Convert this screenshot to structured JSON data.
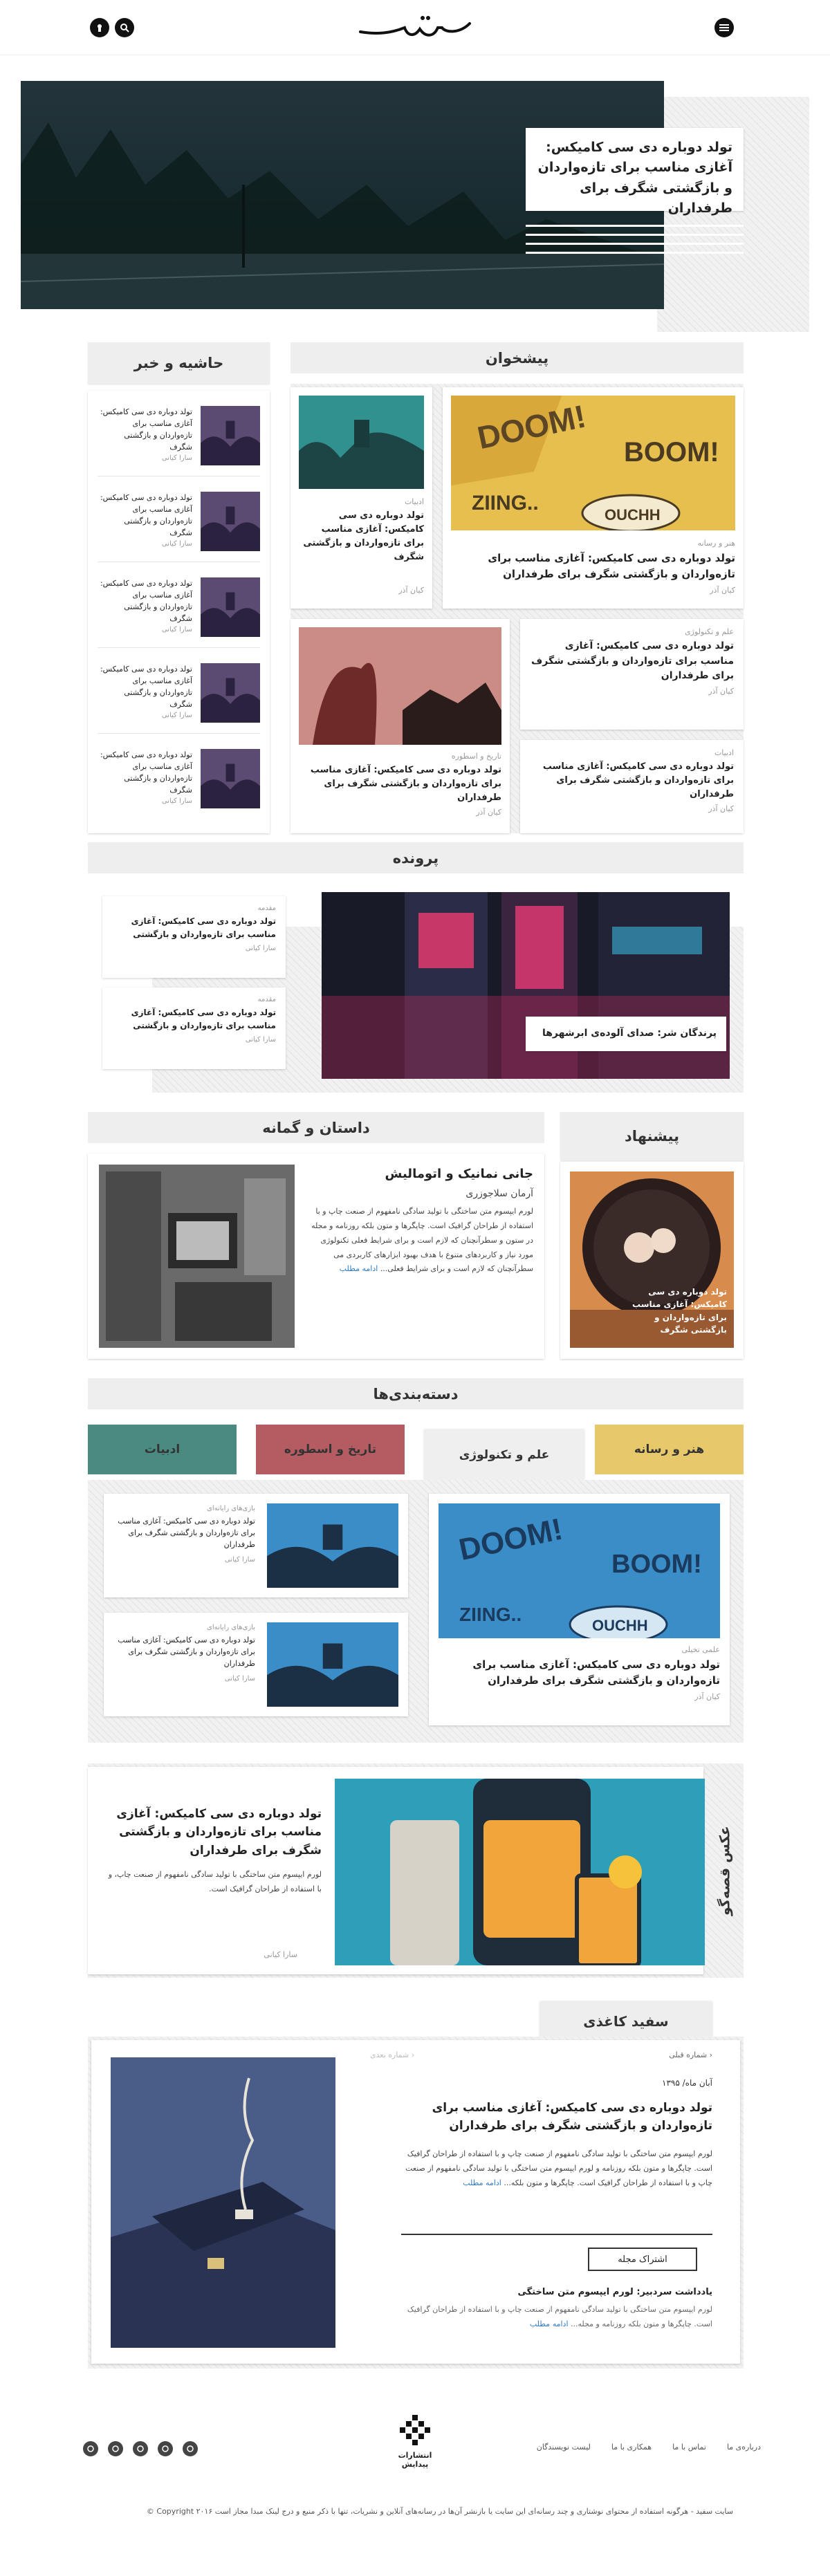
{
  "header": {
    "logo_text": "سفید"
  },
  "hero": {
    "title": "تولد دوباره دی سی کامیکس: آغازی مناسب برای تازه‌واردان و بازگشتی شگرف برای طرفداران"
  },
  "sidebar": {
    "title": "حاشیه و خبر",
    "items": [
      {
        "title": "تولد دوباره دی سی کامیکس: آغازی مناسب برای تازه‌واردان و بازگشتی شگرف",
        "author": "سارا کیانی"
      },
      {
        "title": "تولد دوباره دی سی کامیکس: آغازی مناسب برای تازه‌واردان و بازگشتی شگرف",
        "author": "سارا کیانی"
      },
      {
        "title": "تولد دوباره دی سی کامیکس: آغازی مناسب برای تازه‌واردان و بازگشتی شگرف",
        "author": "سارا کیانی"
      },
      {
        "title": "تولد دوباره دی سی کامیکس: آغازی مناسب برای تازه‌واردان و بازگشتی شگرف",
        "author": "سارا کیانی"
      },
      {
        "title": "تولد دوباره دی سی کامیکس: آغازی مناسب برای تازه‌واردان و بازگشتی شگرف",
        "author": "سارا کیانی"
      }
    ]
  },
  "pishkhan": {
    "title": "پیشخوان",
    "main": {
      "category": "هنر و رسانه",
      "title": "تولد دوباره دی سی کامیکس: آغازی مناسب برای تازه‌واردان و بازگشتی شگرف برای طرفداران",
      "author": "کیان آذر"
    },
    "side": {
      "category": "ادبیات",
      "title": "تولد دوباره دی سی کامیکس: آغازی مناسب برای تازه‌واردان و بازگشتی شگرف",
      "author": "کیان آذر"
    },
    "b1": {
      "category": "علم و تکنولوژی",
      "title": "تولد دوباره دی سی کامیکس: آغازی مناسب برای تازه‌واردان و بازگشتی شگرف برای طرفداران",
      "author": "کیان آذر"
    },
    "b2": {
      "category": "ادبیات",
      "title": "تولد دوباره دی سی کامیکس: آغازی مناسب برای تازه‌واردان و بازگشتی شگرف برای طرفداران",
      "author": "کیان آذر"
    },
    "b3": {
      "category": "تاریخ و اسطوره",
      "title": "تولد دوباره دی سی کامیکس: آغازی مناسب برای تازه‌واردان و بازگشتی شگرف برای طرفداران",
      "author": "کیان آذر"
    }
  },
  "parvande": {
    "title": "پرونده",
    "feature": "پرندگان شر: صدای آلوده‌ی ابرشهرها",
    "items": [
      {
        "category": "مقدمه",
        "title": "تولد دوباره دی سی کامیکس: آغازی مناسب برای تازه‌واردان و بازگشتی",
        "author": "سارا کیانی"
      },
      {
        "category": "مقدمه",
        "title": "تولد دوباره دی سی کامیکس: آغازی مناسب برای تازه‌واردان و بازگشتی",
        "author": "سارا کیانی"
      }
    ]
  },
  "pishnahad": {
    "title": "پیشنهاد",
    "caption": "تولد دوباره دی سی کامیکس: آغازی مناسب برای تازه‌واردان و بازگشتی شگرف"
  },
  "dastan": {
    "title": "داستان و گمانه",
    "story_title": "جانی نمانیک و اتومالیش",
    "author": "آرمان سلاجوزری",
    "body": "لورم ایپسوم متن ساختگی با تولید سادگی نامفهوم از صنعت چاپ و با استفاده از طراحان گرافیک است. چاپگرها و متون بلکه روزنامه و مجله در ستون و سطرآنچنان که لازم است و برای شرایط فعلی تکنولوژی مورد نیاز و کاربردهای متنوع با هدف بهبود ابزارهای کاربردی می سطرآنچنان که لازم است و برای شرایط فعلی...",
    "more": "ادامه مطلب"
  },
  "categories": {
    "title": "دسته‌بندی‌ها",
    "tabs": [
      "هنر و رسانه",
      "علم و تکنولوژی",
      "تاریخ و اسطوره",
      "ادبیات"
    ],
    "main": {
      "category": "علمی تخیلی",
      "title": "تولد دوباره دی سی کامیکس: آغازی مناسب برای تازه‌واردان و بازگشتی شگرف برای طرفداران",
      "author": "کیان آذر"
    },
    "items": [
      {
        "category": "بازی‌های رایانه‌ای",
        "title": "تولد دوباره دی سی کامیکس: آغازی مناسب برای تازه‌واردان و بازگشتی شگرف برای طرفداران",
        "author": "سارا کیانی"
      },
      {
        "category": "بازی‌های رایانه‌ای",
        "title": "تولد دوباره دی سی کامیکس: آغازی مناسب برای تازه‌واردان و بازگشتی شگرف برای طرفداران",
        "author": "سارا کیانی"
      }
    ]
  },
  "aks": {
    "label": "عکس قصه‌گو",
    "title": "تولد دوباره دی سی کامیکس: آغازی مناسب برای تازه‌واردان و بازگشتی شگرف برای طرفداران",
    "body": "لورم ایپسوم متن ساختگی با تولید سادگی نامفهوم از صنعت چاپ، و با استفاده از طراحان گرافیک است.",
    "author": "سارا کیانی"
  },
  "sefid": {
    "tab": "سفید کاغذی",
    "prev": "شماره قبلی",
    "next": "شماره بعدی",
    "date": "آبان ماه/ ۱۳۹۵",
    "title": "تولد دوباره دی سی کامیکس: آغازی مناسب برای تازه‌واردان و بازگشتی شگرف برای طرفداران",
    "body": "لورم ایپسوم متن ساختگی با تولید سادگی نامفهوم از صنعت چاپ و با استفاده از طراحان گرافیک است. چاپگرها و متون بلکه روزنامه و لورم ایپسوم متن ساختگی با تولید سادگی نامفهوم از صنعت چاپ و با استفاده از طراحان گرافیک است. چاپگرها و متون بلکه...",
    "more": "ادامه مطلب",
    "subscribe": "اشتراک مجله",
    "note_title": "یادداشت سردبیر: لورم ایپسوم متن ساختگی",
    "note_body": "لورم ایپسوم متن ساختگی با تولید سادگی نامفهوم از صنعت چاپ و با استفاده از طراحان گرافیک است. چاپگرها و متون بلکه روزنامه و مجله...",
    "note_more": "ادامه مطلب"
  },
  "footer": {
    "links": [
      "درباره‌ی ما",
      "تماس با ما",
      "همکاری با ما",
      "لیست نویسندگان"
    ],
    "publisher": "انتشارات پیدایش",
    "copyright": "سایت سفید - هرگونه استفاده از محتوای نوشتاری و چند رسانه‌ای این سایت یا بازنشر آن‌ها در رسانه‌های آنلاین و نشریات، تنها با ذکر منبع و درج لینک مبدا مجاز است ۲۰۱۶ Copyright ©",
    "socials": [
      "instagram-icon",
      "facebook-icon",
      "twitter-icon",
      "telegram-icon",
      "email-icon"
    ]
  }
}
